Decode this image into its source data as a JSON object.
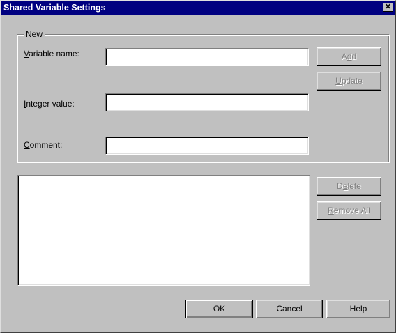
{
  "window": {
    "title": "Shared Variable Settings",
    "close_glyph": "✕",
    "close_icon": "close-icon"
  },
  "group": {
    "legend": "New"
  },
  "fields": {
    "variable_name": {
      "mnemonic": "V",
      "label_rest": "ariable name:",
      "value": ""
    },
    "integer_value": {
      "mnemonic": "I",
      "label_rest": "nteger value:",
      "value": ""
    },
    "comment": {
      "mnemonic": "C",
      "label_rest": "omment:",
      "value": ""
    }
  },
  "buttons": {
    "add": {
      "pre": "A",
      "mnemonic": "d",
      "post": "d",
      "enabled": false
    },
    "update": {
      "pre": "",
      "mnemonic": "U",
      "post": "pdate",
      "enabled": false
    },
    "delete": {
      "pre": "D",
      "mnemonic": "e",
      "post": "lete",
      "enabled": false
    },
    "remove_all": {
      "pre": "",
      "mnemonic": "R",
      "post": "emove All",
      "enabled": false
    },
    "ok": "OK",
    "cancel": "Cancel",
    "help": "Help"
  },
  "list": {
    "items": []
  },
  "colors": {
    "title_bar": "#000080",
    "face": "#c0c0c0",
    "disabled_text": "#808080"
  }
}
